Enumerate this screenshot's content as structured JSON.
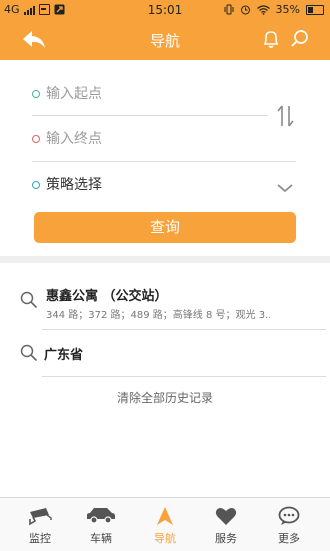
{
  "status_bar": {
    "network": "4G",
    "time": "15:01",
    "battery": "35%"
  },
  "header": {
    "title": "导航"
  },
  "form": {
    "start_placeholder": "输入起点",
    "end_placeholder": "输入终点",
    "strategy_label": "策略选择",
    "query_button": "查询"
  },
  "history": [
    {
      "title": "惠鑫公寓 （公交站）",
      "subtitle": "344 路；372 路；489 路；高锋线 8 号；观光 3..."
    },
    {
      "title": "广东省"
    }
  ],
  "clear_history": "清除全部历史记录",
  "tabs": [
    {
      "label": "监控",
      "icon": "camera-icon",
      "active": false
    },
    {
      "label": "车辆",
      "icon": "car-icon",
      "active": false
    },
    {
      "label": "导航",
      "icon": "navigation-icon",
      "active": true
    },
    {
      "label": "服务",
      "icon": "heart-icon",
      "active": false
    },
    {
      "label": "更多",
      "icon": "chat-more-icon",
      "active": false
    }
  ],
  "colors": {
    "accent": "#f7a23a",
    "start_dot": "#46b49a",
    "end_dot": "#e0626c",
    "strategy_dot": "#2ea5c9"
  }
}
